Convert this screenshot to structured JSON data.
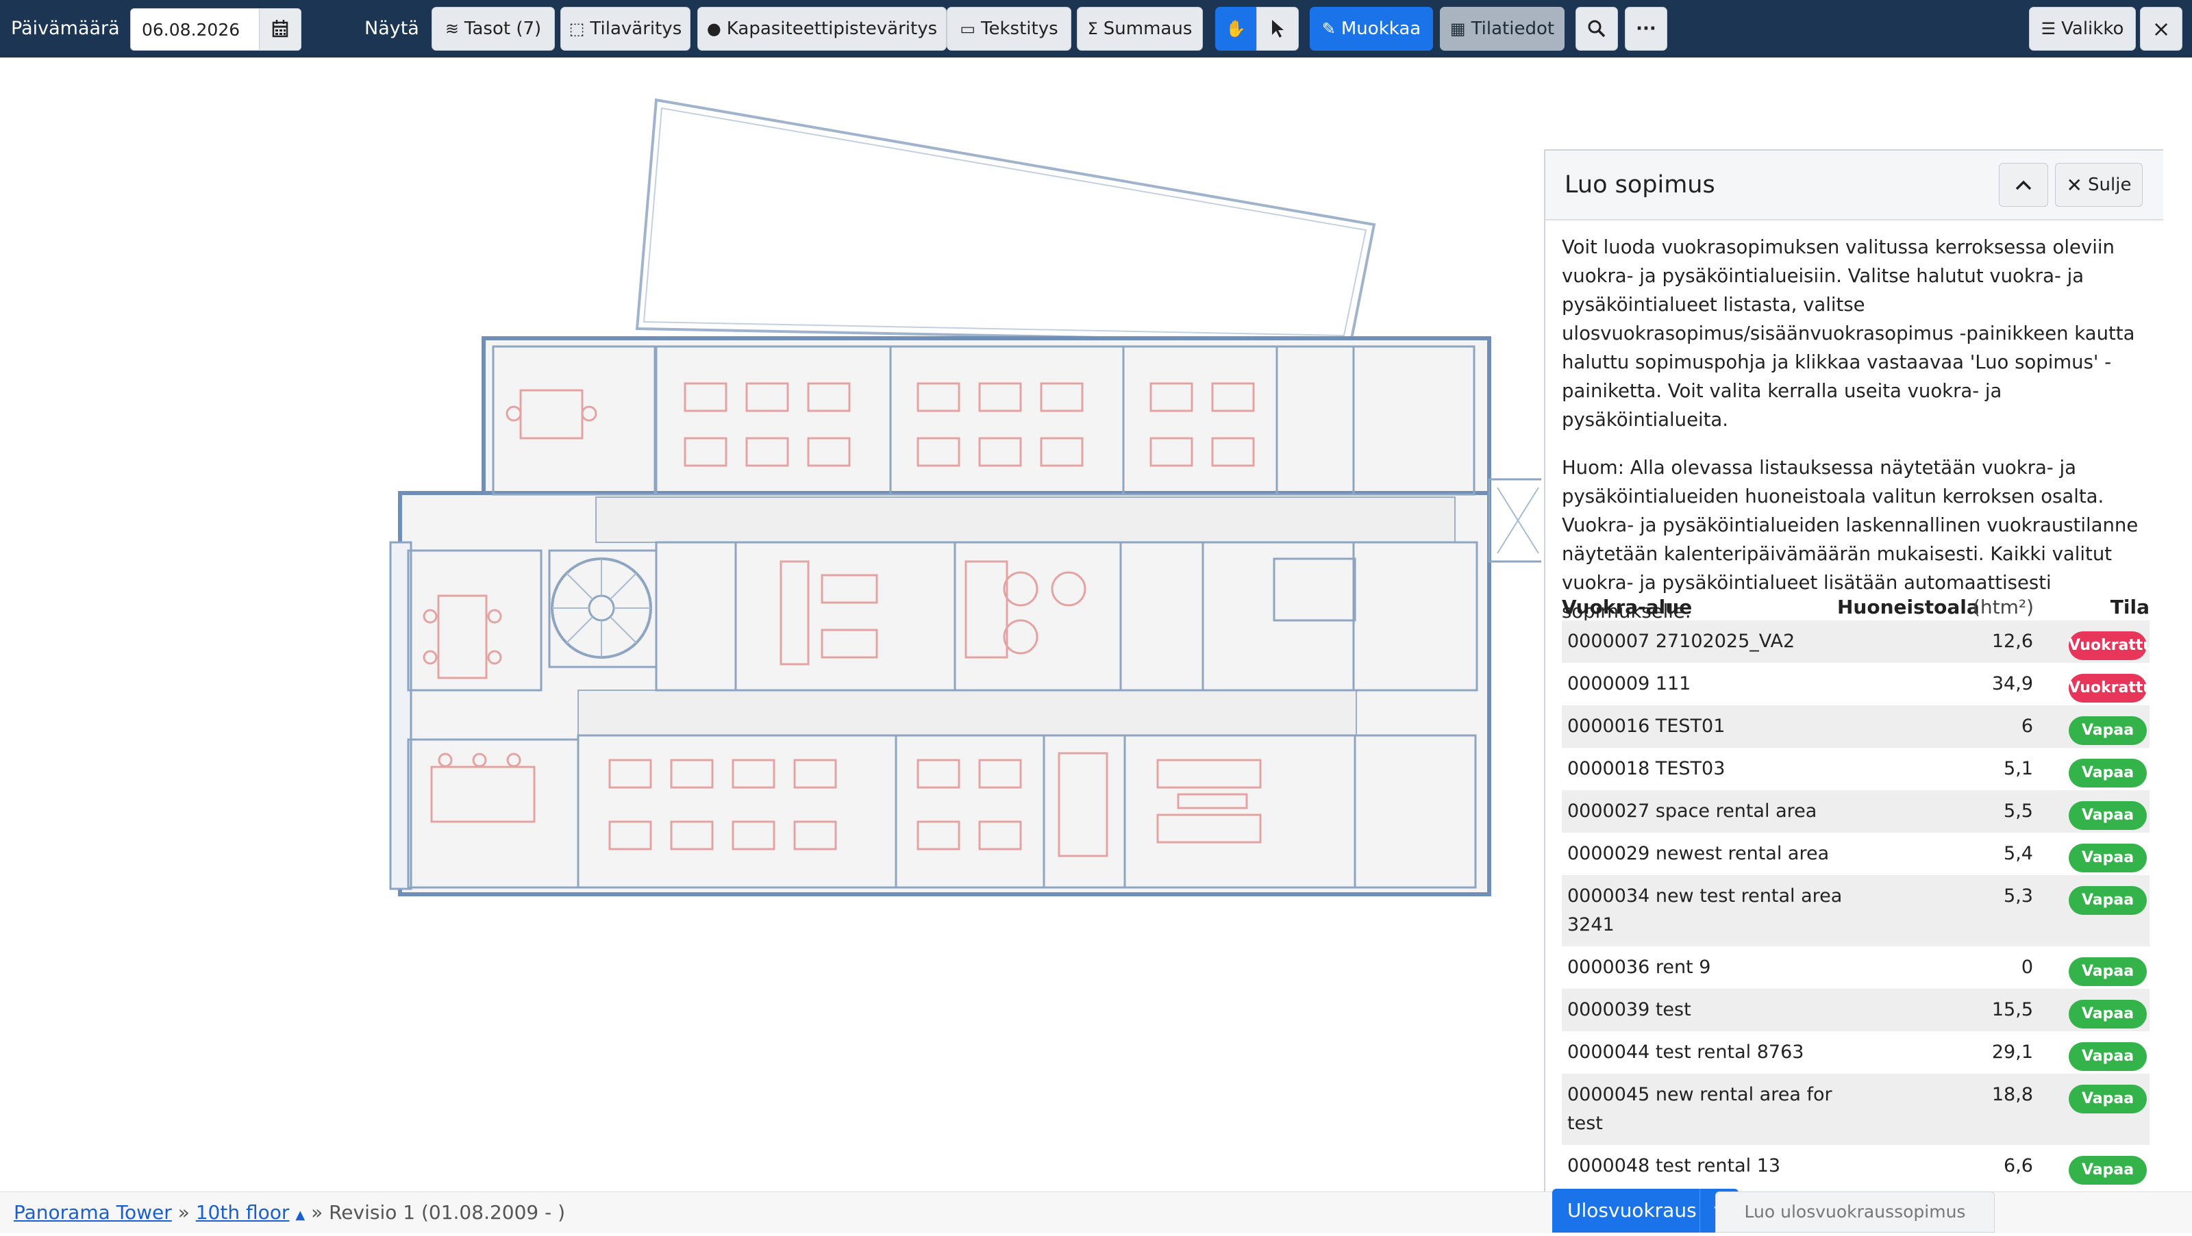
{
  "toolbar": {
    "date_label": "Päivämäärä",
    "date_value": "06.08.2026",
    "show_label": "Näytä",
    "layers": "Tasot (7)",
    "space_coloring": "Tilaväritys",
    "capacity_coloring": "Kapasiteettipisteväritys",
    "labeling": "Tekstitys",
    "summary": "Summaus",
    "edit": "Muokkaa",
    "space_info": "Tilatiedot",
    "more": "···",
    "menu": "Valikko",
    "close": "×"
  },
  "panel": {
    "title": "Luo sopimus",
    "close_label": "Sulje",
    "intro": "Voit luoda vuokrasopimuksen valitussa kerroksessa oleviin vuokra- ja pysäköintialueisiin. Valitse halutut vuokra- ja pysäköintialueet listasta, valitse ulosvuokrasopimus/sisäänvuokrasopimus -painikkeen kautta haluttu sopimuspohja ja klikkaa vastaavaa 'Luo sopimus' -painiketta. Voit valita kerralla useita vuokra- ja pysäköintialueita.",
    "note": "Huom: Alla olevassa listauksessa näytetään vuokra- ja pysäköintialueiden huoneistoala valitun kerroksen osalta. Vuokra- ja pysäköintialueiden laskennallinen vuokraustilanne näytetään kalenteripäivämäärän mukaisesti. Kaikki valitut vuokra- ja pysäköintialueet lisätään automaattisesti sopimukselle.",
    "columns": {
      "area": "Vuokra-alue",
      "size": "Huoneistoala",
      "unit": "(htm²)",
      "status": "Tila"
    },
    "rows": [
      {
        "name": "0000007 27102025_VA2",
        "value": "12,6",
        "status": "Vuokrattu"
      },
      {
        "name": "0000009 111",
        "value": "34,9",
        "status": "Vuokrattu"
      },
      {
        "name": "0000016 TEST01",
        "value": "6",
        "status": "Vapaa"
      },
      {
        "name": "0000018 TEST03",
        "value": "5,1",
        "status": "Vapaa"
      },
      {
        "name": "0000027 space rental area",
        "value": "5,5",
        "status": "Vapaa"
      },
      {
        "name": "0000029 newest rental area",
        "value": "5,4",
        "status": "Vapaa"
      },
      {
        "name": "0000034 new test rental area 3241",
        "value": "5,3",
        "status": "Vapaa"
      },
      {
        "name": "0000036 rent 9",
        "value": "0",
        "status": "Vapaa"
      },
      {
        "name": "0000039 test",
        "value": "15,5",
        "status": "Vapaa"
      },
      {
        "name": "0000044 test rental 8763",
        "value": "29,1",
        "status": "Vapaa"
      },
      {
        "name": "0000045 new rental area for test",
        "value": "18,8",
        "status": "Vapaa"
      },
      {
        "name": "0000048 test rental 13",
        "value": "6,6",
        "status": "Vapaa"
      }
    ]
  },
  "breadcrumb": {
    "building": "Panorama Tower",
    "sep1": "»",
    "floor": "10th floor",
    "revision": "» Revisio 1 (01.08.2009 - )"
  },
  "actions": {
    "lease_out": "Ulosvuokraus",
    "create_lease_out": "Luo ulosvuokraussopimus"
  },
  "colors": {
    "toolbar_bg": "#1c3552",
    "primary": "#1a73e8",
    "rented": "#e8365a",
    "free": "#34b34a"
  }
}
